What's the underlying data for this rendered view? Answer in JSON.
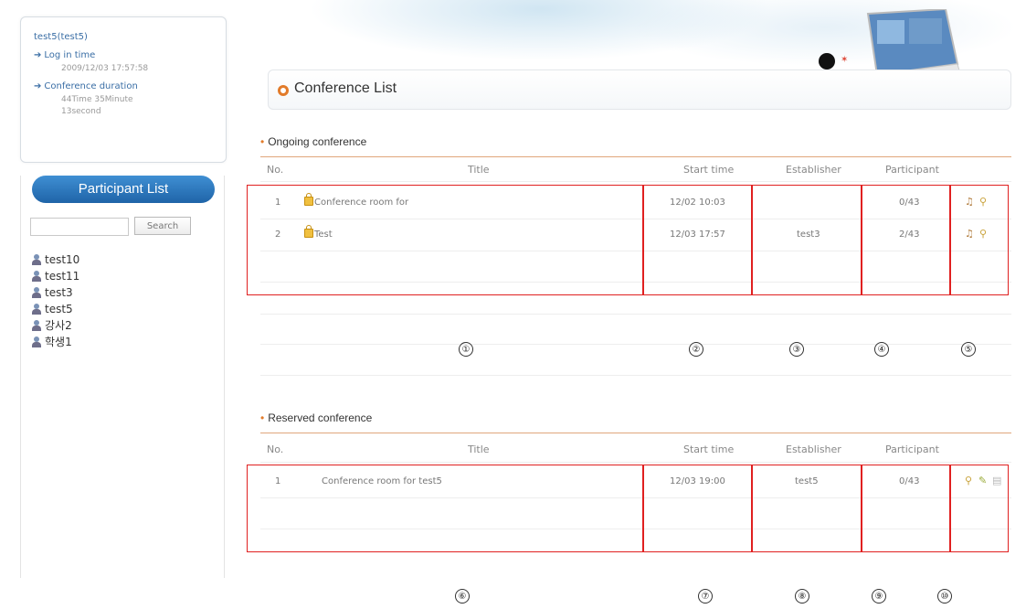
{
  "user_box": {
    "username": "test5(test5)",
    "login_label": "Log in time",
    "login_value": "2009/12/03 17:57:58",
    "duration_label": "Conference duration",
    "duration_value_line1": "44Time 35Minute",
    "duration_value_line2": "13second"
  },
  "participant_list": {
    "header": "Participant List",
    "search_placeholder": "",
    "search_button": "Search",
    "items": [
      "test10",
      "test11",
      "test3",
      "test5",
      "강사2",
      "학생1"
    ]
  },
  "page_title": "Conference List",
  "ongoing": {
    "section_title": "Ongoing conference",
    "columns": [
      "No.",
      "Title",
      "Start time",
      "Establisher",
      "Participant"
    ],
    "rows": [
      {
        "no": "1",
        "title": "Conference room for",
        "start": "12/02 10:03",
        "establisher": "",
        "participant": "0/43",
        "actions": [
          "join-icon",
          "view-icon"
        ]
      },
      {
        "no": "2",
        "title": "Test",
        "start": "12/03 17:57",
        "establisher": "test3",
        "participant": "2/43",
        "actions": [
          "join-icon",
          "view-icon"
        ]
      }
    ]
  },
  "reserved": {
    "section_title": "Reserved conference",
    "columns": [
      "No.",
      "Title",
      "Start time",
      "Establisher",
      "Participant"
    ],
    "rows": [
      {
        "no": "1",
        "title": "Conference room for test5",
        "start": "12/03 19:00",
        "establisher": "test5",
        "participant": "0/43",
        "actions": [
          "view-icon",
          "edit-icon",
          "delete-icon"
        ]
      }
    ]
  },
  "markers": [
    "①",
    "②",
    "③",
    "④",
    "⑤",
    "⑥",
    "⑦",
    "⑧",
    "⑨",
    "⑩"
  ],
  "colors": {
    "accent_orange": "#e27b2a",
    "header_blue": "#2f7bc2",
    "annotation_red": "#e02020"
  }
}
